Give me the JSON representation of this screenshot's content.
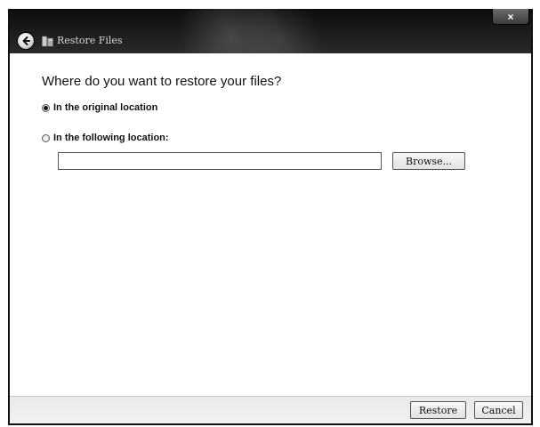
{
  "window": {
    "title": "Restore Files",
    "close_label": "×"
  },
  "main": {
    "heading": "Where do you want to restore your files?",
    "options": [
      {
        "label": "In the original location",
        "selected": true
      },
      {
        "label": "In the following location:",
        "selected": false
      }
    ],
    "location_input": {
      "value": "",
      "placeholder": ""
    },
    "browse_label": "Browse..."
  },
  "footer": {
    "restore_label": "Restore",
    "cancel_label": "Cancel"
  }
}
